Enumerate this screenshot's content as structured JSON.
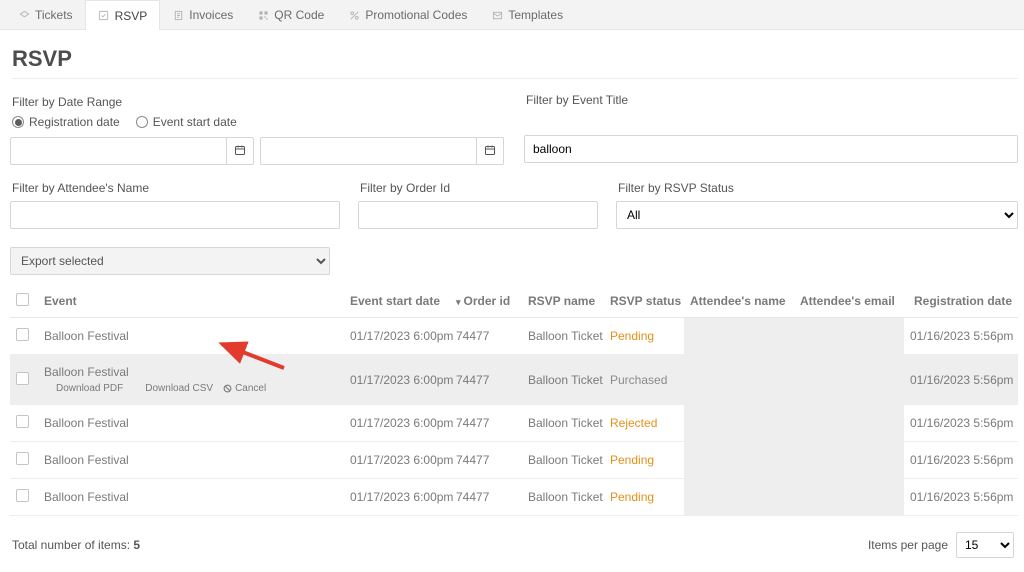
{
  "tabs": {
    "tickets": "Tickets",
    "rsvp": "RSVP",
    "invoices": "Invoices",
    "qr": "QR Code",
    "promo": "Promotional Codes",
    "templates": "Templates"
  },
  "page_title": "RSVP",
  "filter_date_label": "Filter by Date Range",
  "radio": {
    "registration": "Registration date",
    "eventstart": "Event start date"
  },
  "filter_event_title_label": "Filter by Event Title",
  "event_title_value": "balloon",
  "filter_attendee_label": "Filter by Attendee's Name",
  "filter_order_label": "Filter by Order Id",
  "filter_status_label": "Filter by RSVP Status",
  "status_select_value": "All",
  "export_select_value": "Export selected",
  "columns": {
    "event": "Event",
    "start": "Event start date",
    "order": "Order id",
    "rsvp": "RSVP name",
    "status": "RSVP status",
    "aname": "Attendee's name",
    "aemail": "Attendee's email",
    "reg": "Registration date"
  },
  "rows": [
    {
      "event": "Balloon Festival",
      "start": "01/17/2023 6:00pm",
      "order": "74477",
      "rsvp": "Balloon Ticket",
      "status": "Pending",
      "status_class": "status-pending",
      "reg": "01/16/2023 5:56pm",
      "highlight": false,
      "actions": false
    },
    {
      "event": "Balloon Festival",
      "start": "01/17/2023 6:00pm",
      "order": "74477",
      "rsvp": "Balloon Ticket",
      "status": "Purchased",
      "status_class": "status-purchased",
      "reg": "01/16/2023 5:56pm",
      "highlight": true,
      "actions": true
    },
    {
      "event": "Balloon Festival",
      "start": "01/17/2023 6:00pm",
      "order": "74477",
      "rsvp": "Balloon Ticket",
      "status": "Rejected",
      "status_class": "status-rejected",
      "reg": "01/16/2023 5:56pm",
      "highlight": false,
      "actions": false
    },
    {
      "event": "Balloon Festival",
      "start": "01/17/2023 6:00pm",
      "order": "74477",
      "rsvp": "Balloon Ticket",
      "status": "Pending",
      "status_class": "status-pending",
      "reg": "01/16/2023 5:56pm",
      "highlight": false,
      "actions": false
    },
    {
      "event": "Balloon Festival",
      "start": "01/17/2023 6:00pm",
      "order": "74477",
      "rsvp": "Balloon Ticket",
      "status": "Pending",
      "status_class": "status-pending",
      "reg": "01/16/2023 5:56pm",
      "highlight": false,
      "actions": false
    }
  ],
  "row_actions": {
    "pdf": "Download PDF",
    "csv": "Download CSV",
    "cancel": "Cancel"
  },
  "footer": {
    "total_label": "Total number of items: ",
    "total_value": "5",
    "ipp_label": "Items per page",
    "ipp_value": "15"
  }
}
